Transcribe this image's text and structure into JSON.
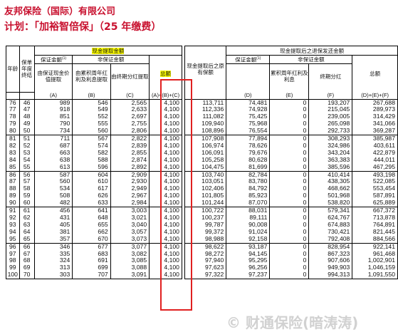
{
  "page": {
    "company_title": "友邦保险（国际）有限公司",
    "plan_title": "计划：「加裕智倍保」（25 年缴费）",
    "watermark": "© 财通保险(暗涛涛)"
  },
  "header": {
    "age": "年龄",
    "policy_year": "保单年度终结",
    "cash_withdrawal": "现金提取金额",
    "guaranteed_amount": "保证金额",
    "guaranteed_amount_sup": "(1)",
    "non_guaranteed": "非保证金额",
    "col_a": "由保证现金价值提取",
    "col_b": "由累积周年红利及利息提取",
    "col_c": "由终期分红提取",
    "col_total_abc": "总额",
    "col_cv_after": "现金提取后之原有保额",
    "surrender_after": "现金提取后之退保发还金额",
    "col_d_group": "保证金额",
    "col_d_group_sup": "(1)",
    "col_e": "累积周年红利及利息",
    "col_f": "终期分红",
    "col_total_def": "总额",
    "label_a": "(A)",
    "label_b": "(B)",
    "label_c": "(C)",
    "label_abc": "(A)+(B)+(C)",
    "label_d": "(D)",
    "label_e": "(E)",
    "label_f": "(F)",
    "label_def": "(D)+(E)+(F)"
  },
  "chart_data": {
    "type": "table",
    "columns": [
      "年龄",
      "保单年度终结",
      "(A)",
      "(B)",
      "(C)",
      "(A)+(B)+(C)",
      "现金提取后之原有保额",
      "(D)",
      "(E)",
      "(F)",
      "(D)+(E)+(F)"
    ],
    "rows": [
      [
        "76",
        "46",
        "989",
        "546",
        "2,565",
        "4,100",
        "113,711",
        "74,481",
        "0",
        "193,207",
        "267,688"
      ],
      [
        "77",
        "47",
        "918",
        "549",
        "2,633",
        "4,100",
        "112,336",
        "74,928",
        "0",
        "215,045",
        "289,973"
      ],
      [
        "78",
        "48",
        "851",
        "552",
        "2,697",
        "4,100",
        "111,082",
        "75,425",
        "0",
        "239,005",
        "314,429"
      ],
      [
        "79",
        "49",
        "790",
        "555",
        "2,755",
        "4,100",
        "109,940",
        "75,968",
        "0",
        "265,098",
        "341,066"
      ],
      [
        "80",
        "50",
        "734",
        "560",
        "2,806",
        "4,100",
        "108,896",
        "76,554",
        "0",
        "292,733",
        "369,287"
      ],
      [
        "81",
        "51",
        "711",
        "567",
        "2,822",
        "4,100",
        "107,908",
        "77,894",
        "0",
        "308,293",
        "385,987"
      ],
      [
        "82",
        "52",
        "687",
        "574",
        "2,839",
        "4,100",
        "106,974",
        "78,626",
        "0",
        "324,986",
        "403,611"
      ],
      [
        "83",
        "53",
        "663",
        "582",
        "2,855",
        "4,100",
        "106,091",
        "79,676",
        "0",
        "343,204",
        "422,879"
      ],
      [
        "84",
        "54",
        "638",
        "588",
        "2,874",
        "4,100",
        "105,258",
        "80,628",
        "0",
        "363,383",
        "444,011"
      ],
      [
        "85",
        "55",
        "613",
        "596",
        "2,892",
        "4,100",
        "104,475",
        "81,699",
        "0",
        "385,596",
        "467,295"
      ],
      [
        "86",
        "56",
        "587",
        "604",
        "2,909",
        "4,100",
        "103,740",
        "82,784",
        "0",
        "410,414",
        "493,198"
      ],
      [
        "87",
        "57",
        "560",
        "610",
        "2,930",
        "4,100",
        "103,051",
        "83,780",
        "0",
        "438,305",
        "522,085"
      ],
      [
        "88",
        "58",
        "534",
        "617",
        "2,949",
        "4,100",
        "102,406",
        "84,792",
        "0",
        "468,662",
        "553,454"
      ],
      [
        "89",
        "59",
        "508",
        "626",
        "2,967",
        "4,100",
        "101,805",
        "85,923",
        "0",
        "501,968",
        "587,891"
      ],
      [
        "90",
        "60",
        "482",
        "633",
        "2,984",
        "4,100",
        "101,244",
        "87,070",
        "0",
        "538,820",
        "625,889"
      ],
      [
        "91",
        "61",
        "456",
        "641",
        "3,003",
        "4,100",
        "100,722",
        "88,031",
        "0",
        "579,341",
        "667,372"
      ],
      [
        "92",
        "62",
        "431",
        "648",
        "3,021",
        "4,100",
        "100,237",
        "89,111",
        "0",
        "624,767",
        "713,878"
      ],
      [
        "93",
        "63",
        "405",
        "655",
        "3,040",
        "4,100",
        "99,787",
        "90,008",
        "0",
        "674,883",
        "764,891"
      ],
      [
        "94",
        "64",
        "381",
        "662",
        "3,057",
        "4,100",
        "99,372",
        "91,024",
        "0",
        "730,421",
        "821,445"
      ],
      [
        "95",
        "65",
        "357",
        "670",
        "3,073",
        "4,100",
        "98,988",
        "92,158",
        "0",
        "792,408",
        "884,566"
      ],
      [
        "96",
        "66",
        "346",
        "677",
        "3,077",
        "4,100",
        "98,622",
        "93,187",
        "0",
        "828,954",
        "922,141"
      ],
      [
        "97",
        "67",
        "335",
        "683",
        "3,082",
        "4,100",
        "98,272",
        "94,145",
        "0",
        "867,323",
        "961,468"
      ],
      [
        "98",
        "68",
        "324",
        "691",
        "3,085",
        "4,100",
        "97,940",
        "95,295",
        "0",
        "907,606",
        "1,002,901"
      ],
      [
        "99",
        "69",
        "313",
        "699",
        "3,088",
        "4,100",
        "97,623",
        "96,256",
        "0",
        "949,903",
        "1,046,159"
      ],
      [
        "100",
        "70",
        "303",
        "707",
        "3,091",
        "4,100",
        "97,322",
        "97,237",
        "0",
        "994,313",
        "1,091,550"
      ]
    ],
    "group_size": 5
  }
}
